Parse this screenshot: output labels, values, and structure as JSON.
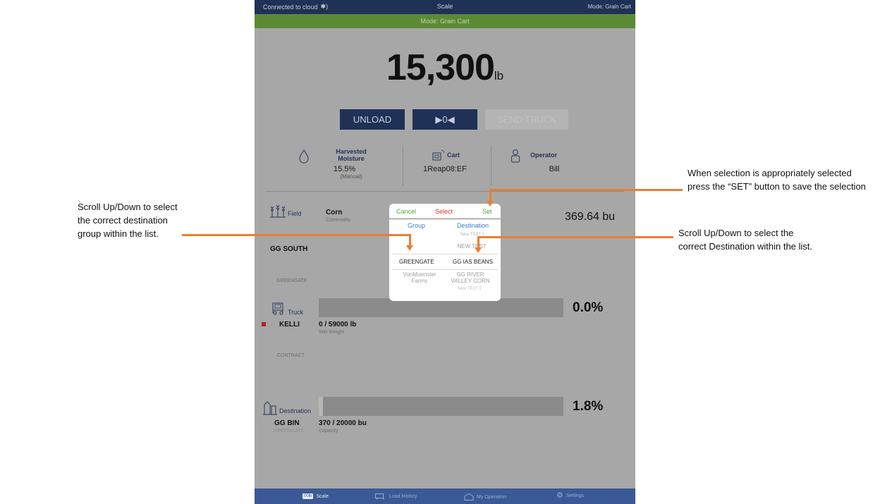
{
  "status_bar": {
    "connection": "Connected to cloud",
    "title": "Scale",
    "mode": "Mode: Grain Cart"
  },
  "mode_banner": "Mode: Grain Cart",
  "weight": {
    "value": "15,300",
    "unit": "lb"
  },
  "buttons": {
    "unload": "UNLOAD",
    "zero": "▶0◀",
    "send_truck": "SEND TRUCK"
  },
  "info": {
    "moisture": {
      "title_line1": "Harvested",
      "title_line2": "Moisture",
      "value": "15.5%",
      "note": "(Manual)"
    },
    "cart": {
      "title": "Cart",
      "value": "1Reap08:EF"
    },
    "operator": {
      "title": "Operator",
      "value": "Bill"
    }
  },
  "field": {
    "label": "Field",
    "commodity": "Corn",
    "commodity_sub": "Commodity",
    "amount": "369.64 bu",
    "name": "GG SOUTH",
    "sub": "GREENGATE"
  },
  "truck": {
    "label": "Truck",
    "name": "KELLI",
    "load": "0 / 59000 lb",
    "load_sub": "Wet Weight",
    "percent": "0.0%",
    "fill": 0.0,
    "sub": "CONTRACT"
  },
  "destination": {
    "label": "Destination",
    "name": "GG BIN",
    "sub": "GREENGATE",
    "load": "370 / 20000 bu",
    "load_sub": "Capacity",
    "percent": "1.8%",
    "fill": 0.018
  },
  "picker": {
    "cancel": "Cancel",
    "title": "Select",
    "set": "Set",
    "col_group": "Group",
    "col_destination": "Destination",
    "dest_above_2": "New TEST 1",
    "dest_above_1": "NEW TEST",
    "group_selected": "GREENGATE",
    "dest_selected": "GG IAS BEANS",
    "group_below_1": "VonMuenster Farms",
    "dest_below_1": "GG RIVER VALLEY CORN",
    "dest_below_2": "New TEST 2"
  },
  "tabs": [
    {
      "label": "Scale",
      "chip": "00lb",
      "active": true
    },
    {
      "label": "Load History"
    },
    {
      "label": "My Operation"
    },
    {
      "label": "Settings"
    }
  ],
  "annotations": {
    "set_note_line1": "When selection is appropriately selected",
    "set_note_line2": "press the “SET” button to save the selection",
    "group_note_line1": "Scroll Up/Down to select",
    "group_note_line2": "the correct destination",
    "group_note_line3": "group within the list.",
    "dest_note_line1": "Scroll Up/Down to select the",
    "dest_note_line2": "correct Destination within the list."
  },
  "colors": {
    "navy": "#1f3157",
    "green": "#5a8a34",
    "accent_orange": "#ed7d31",
    "picker_blue": "#3a7bc8",
    "picker_red": "#e0302b",
    "picker_green": "#5aa03c"
  }
}
